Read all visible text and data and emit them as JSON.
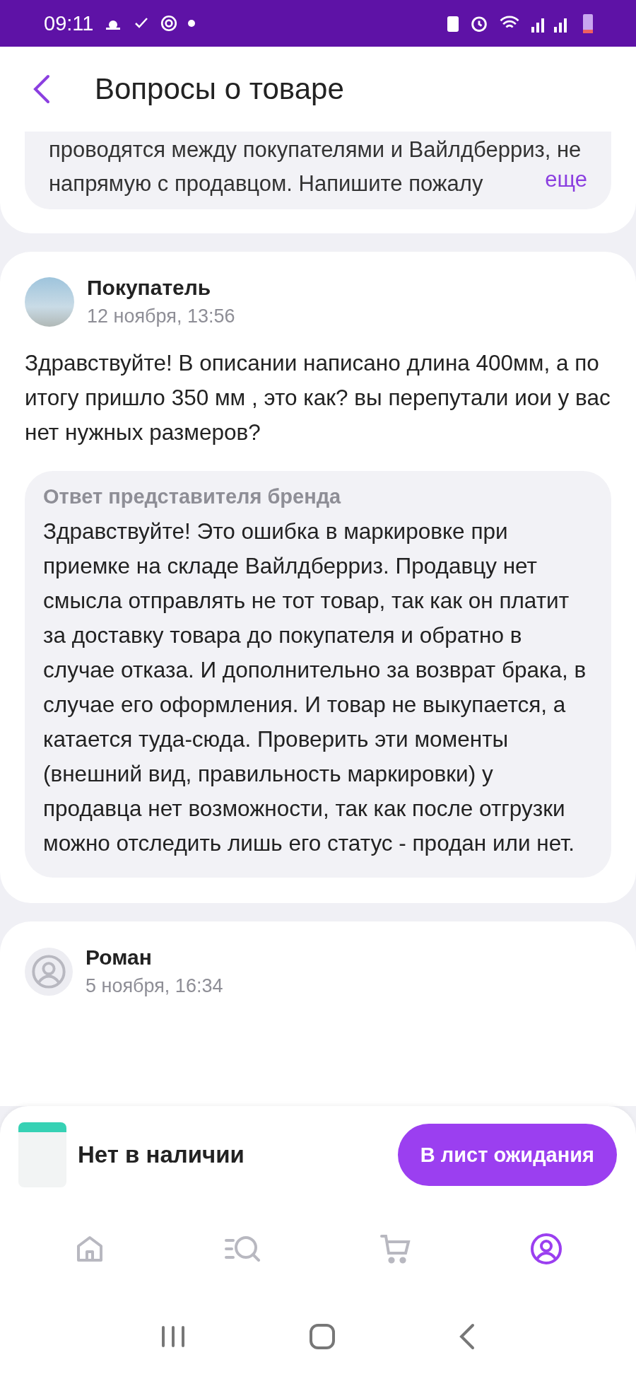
{
  "status_bar": {
    "time": "09:11"
  },
  "header": {
    "title": "Вопросы о товаре"
  },
  "notice": {
    "text": "проводятся между покупателями и Вайлдберриз, не напрямую с продавцом. Напишите пожалу",
    "more": "еще"
  },
  "questions": [
    {
      "kind": "photo",
      "author": "Покупатель",
      "date": "12 ноября, 13:56",
      "text": "Здравствуйте! В описании написано длина 400мм, а по итогу пришло 350 мм , это как? вы перепутали иои у вас нет нужных размеров?",
      "answer": {
        "title": "Ответ представителя бренда",
        "text": "Здравствуйте! Это ошибка в маркировке при приемке на складе Вайлдберриз. Продавцу нет смысла отправлять не тот товар, так как он платит за доставку товара до покупателя и обратно в случае отказа. И дополнительно за возврат брака, в случае его оформления.  И товар не выкупается, а катается туда-сюда. Проверить эти моменты (внешний вид, правильность маркировки) у продавца нет возможности, так как после отгрузки можно отследить лишь его статус - продан или нет."
      }
    },
    {
      "kind": "default",
      "author": "Роман",
      "date": "5 ноября, 16:34"
    }
  ],
  "purchase_bar": {
    "status": "Нет в наличии",
    "button": "В лист ожидания"
  },
  "bottom_nav": [
    {
      "kind": "home",
      "selected": false
    },
    {
      "kind": "catalog",
      "selected": false
    },
    {
      "kind": "cart",
      "selected": false
    },
    {
      "kind": "profile",
      "selected": true
    }
  ]
}
